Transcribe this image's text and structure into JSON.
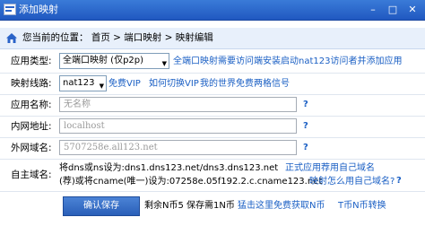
{
  "window": {
    "title": "添加映射",
    "min": "–",
    "max": "□",
    "close": "✕"
  },
  "breadcrumb": {
    "text": "您当前的位置： 首页 > 端口映射 > 映射编辑"
  },
  "form": {
    "app_type": {
      "label": "应用类型:",
      "value": "全端口映射 (仅p2p)",
      "note": "全端口映射需要访问端安装启动nat123访问者并添加应用"
    },
    "mapping_line": {
      "label": "映射线路:",
      "value": "nat123",
      "links": [
        "免费VIP",
        "如何切换VIP",
        "我的世界免费两格信号"
      ]
    },
    "app_name": {
      "label": "应用名称:",
      "placeholder": "无名称"
    },
    "internal_addr": {
      "label": "内网地址:",
      "value": "localhost"
    },
    "external_domain": {
      "label": "外网域名:",
      "value": "5707258e.all123.net"
    },
    "custom_domain": {
      "label": "自主域名:",
      "line1_prefix": "将dns或ns设为:",
      "line1_value": "dns1.dns123.net/dns3.dns123.net",
      "line1_link": "正式应用荐用自己域名",
      "line2_prefix": "(荐)或将cname(唯一)设为:",
      "line2_value": "07258e.05f192.2.c.cname123.net",
      "line2_link": "映射怎么用自己域名?"
    }
  },
  "footer": {
    "save_label": "确认保存",
    "quota_text": "剩余N币5 保存需1N币",
    "free_link": "猛击这里免费获取N币",
    "convert_link": "T币N币转换"
  },
  "qmark": "?",
  "colors": {
    "titlebar": "#2a63c8",
    "link": "#1a5fc4"
  }
}
